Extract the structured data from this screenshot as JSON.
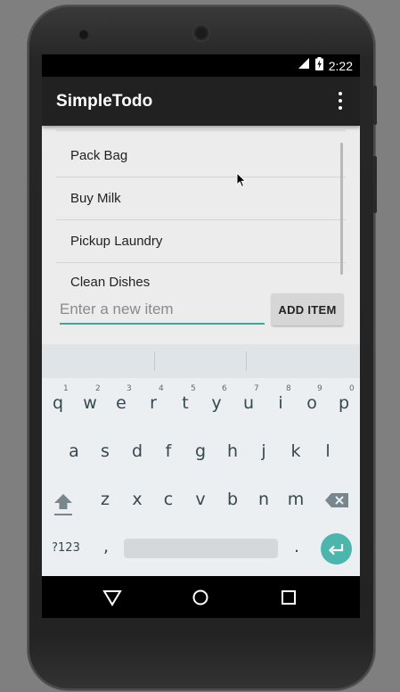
{
  "status": {
    "time": "2:22",
    "icons": [
      "signal-icon",
      "battery-charging-icon"
    ]
  },
  "appbar": {
    "title": "SimpleTodo",
    "menu_icon": "overflow-menu-icon"
  },
  "todo_list": {
    "items": [
      {
        "label": "Pack Bag"
      },
      {
        "label": "Buy Milk"
      },
      {
        "label": "Pickup Laundry"
      },
      {
        "label": "Clean Dishes"
      }
    ]
  },
  "new_item": {
    "placeholder": "Enter a new item",
    "value": "",
    "add_label": "ADD ITEM"
  },
  "keyboard": {
    "row1": [
      "q",
      "w",
      "e",
      "r",
      "t",
      "y",
      "u",
      "i",
      "o",
      "p"
    ],
    "row1_hints": [
      "1",
      "2",
      "3",
      "4",
      "5",
      "6",
      "7",
      "8",
      "9",
      "0"
    ],
    "row2": [
      "a",
      "s",
      "d",
      "f",
      "g",
      "h",
      "j",
      "k",
      "l"
    ],
    "row3": [
      "z",
      "x",
      "c",
      "v",
      "b",
      "n",
      "m"
    ],
    "symbols_label": "?123",
    "comma": ",",
    "period": ".",
    "enter_color": "#4db6ac"
  },
  "colors": {
    "accent": "#3aa99a",
    "appbar": "#212121",
    "screen_bg": "#ececec"
  }
}
